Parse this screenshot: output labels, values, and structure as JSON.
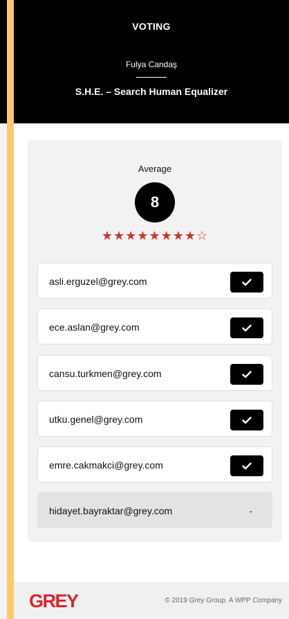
{
  "header": {
    "title": "VOTING",
    "person_name": "Fulya Candaş",
    "project_title": "S.H.E. – Search Human Equalizer"
  },
  "summary": {
    "label": "Average",
    "score": "8",
    "rating": {
      "filled": 8,
      "total": 9
    }
  },
  "voters": [
    {
      "email": "asli.erguzel@grey.com",
      "status": "voted"
    },
    {
      "email": "ece.aslan@grey.com",
      "status": "voted"
    },
    {
      "email": "cansu.turkmen@grey.com",
      "status": "voted"
    },
    {
      "email": "utku.genel@grey.com",
      "status": "voted"
    },
    {
      "email": "emre.cakmakci@grey.com",
      "status": "voted"
    },
    {
      "email": "hidayet.bayraktar@grey.com",
      "status": "pending",
      "status_text": "-"
    }
  ],
  "footer": {
    "logo": "GREY",
    "copyright": "© 2019 Grey Group. A WPP Company"
  },
  "colors": {
    "accent_bar": "#fcc968",
    "star": "#c0392b",
    "brand_red": "#d7262b",
    "header_bg": "#000000"
  }
}
